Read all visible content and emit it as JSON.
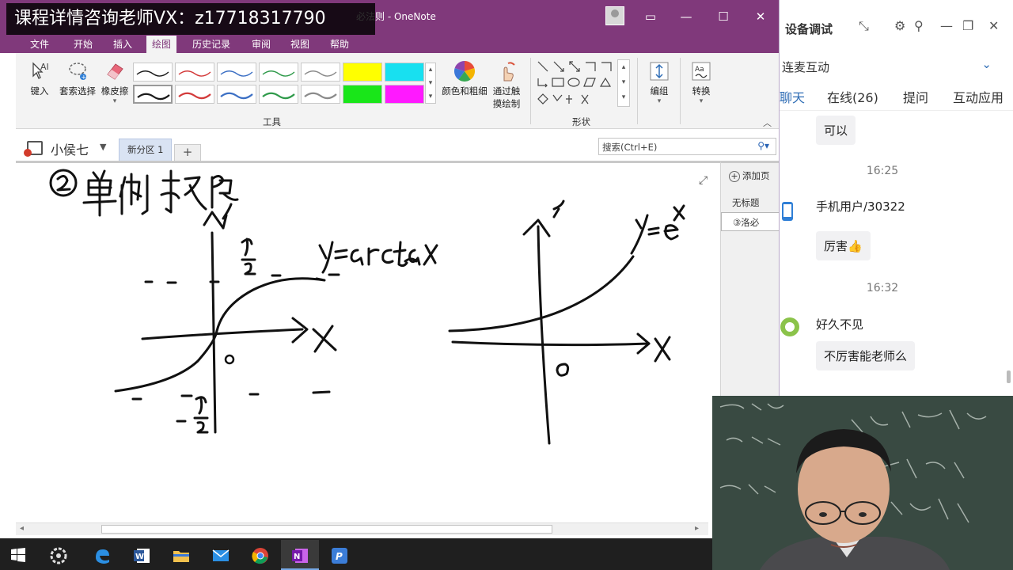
{
  "watermark": "课程详情咨询老师VX：z17718317790",
  "window": {
    "title_left": "必法则",
    "app_title": "OneNote",
    "controls": [
      "▭",
      "—",
      "☐",
      "✕"
    ]
  },
  "menu": [
    "文件",
    "开始",
    "插入",
    "绘图",
    "历史记录",
    "审阅",
    "视图",
    "帮助"
  ],
  "menu_active_index": 3,
  "ribbon": {
    "type_label": "键入",
    "lasso_label": "套索选择",
    "eraser_label": "橡皮擦",
    "color_label": "颜色和粗细",
    "touch_label_1": "通过触",
    "touch_label_2": "摸绘制",
    "tools_group": "工具",
    "shapes_group": "形状",
    "group_label": "编组",
    "convert_label": "转换",
    "pen_colors": [
      "#1a1a1a",
      "#d33a3a",
      "#3b6fc4",
      "#2f9a4a",
      "#8a8a8a"
    ],
    "highlighter_colors_top": [
      "#ffff00",
      "#18e0f0"
    ],
    "highlighter_colors_bottom": [
      "#19e619",
      "#ff19ff"
    ]
  },
  "notebook": {
    "name": "小侯七",
    "section": "新分区 1",
    "add_section": "+",
    "search_placeholder": "搜索(Ctrl+E)"
  },
  "pages": {
    "add_page": "添加页",
    "items": [
      "无标题",
      "③洛必"
    ]
  },
  "live": {
    "title": "设备调试",
    "section": "连麦互动",
    "tabs": [
      "聊天",
      "在线(26)",
      "提问",
      "互动应用"
    ],
    "active_tab": 0,
    "messages": [
      {
        "kind": "bubble",
        "text": "可以"
      },
      {
        "kind": "time",
        "text": "16:25"
      },
      {
        "kind": "user",
        "text": "手机用户/30322"
      },
      {
        "kind": "bubble",
        "text": "厉害👍"
      },
      {
        "kind": "time",
        "text": "16:32"
      },
      {
        "kind": "user",
        "text": "好久不见"
      },
      {
        "kind": "bubble",
        "text": "不厉害能老师么"
      }
    ]
  },
  "taskbar": {
    "apps": [
      "windows-start",
      "system-settings",
      "edge",
      "word",
      "file-explorer",
      "mail",
      "chrome",
      "onenote",
      "pdf"
    ],
    "active_index": 7
  }
}
